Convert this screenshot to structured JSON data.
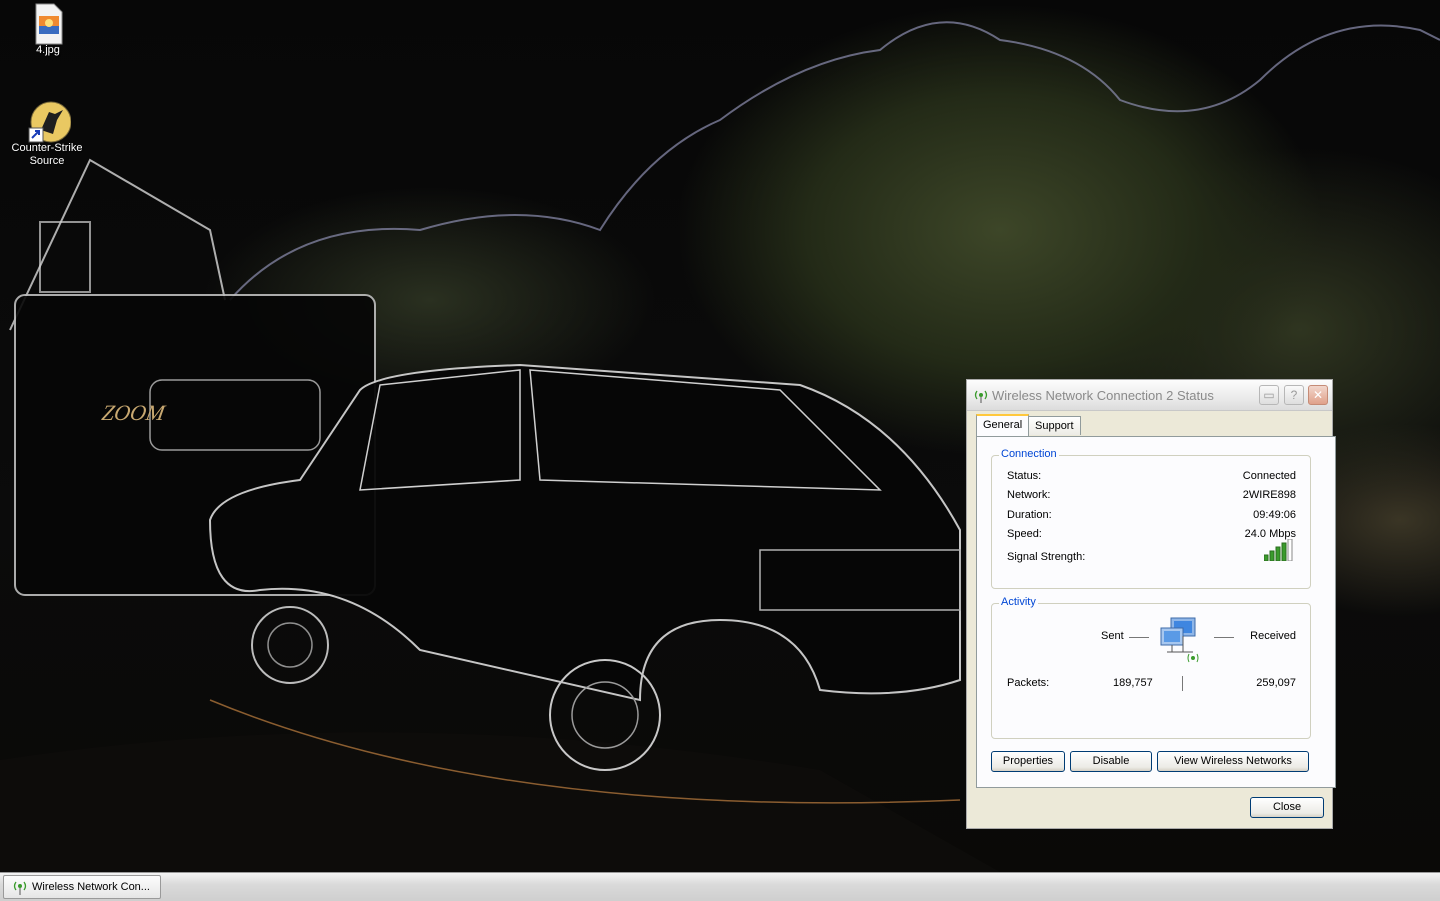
{
  "desktop": {
    "icons": [
      {
        "label": "4.jpg",
        "icon": "image-file-icon"
      },
      {
        "label": "Counter-Strike Source",
        "icon": "counter-strike-icon"
      }
    ]
  },
  "dialog": {
    "title": "Wireless Network Connection 2 Status",
    "tabs": [
      "General",
      "Support"
    ],
    "active_tab": "General",
    "connection": {
      "label": "Connection",
      "status_label": "Status:",
      "status_value": "Connected",
      "network_label": "Network:",
      "network_value": "2WIRE898",
      "duration_label": "Duration:",
      "duration_value": "09:49:06",
      "speed_label": "Speed:",
      "speed_value": "24.0 Mbps",
      "signal_label": "Signal Strength:",
      "signal_bars": 5,
      "signal_bars_active": 4
    },
    "activity": {
      "label": "Activity",
      "sent_label": "Sent",
      "received_label": "Received",
      "packets_label": "Packets:",
      "packets_sent": "189,757",
      "packets_received": "259,097"
    },
    "buttons": {
      "properties": "Properties",
      "disable": "Disable",
      "view_networks": "View Wireless Networks",
      "close": "Close"
    },
    "titlebar_buttons": {
      "help": "?",
      "close": "✕"
    },
    "colors": {
      "group_label": "#0046d5",
      "signal_on": "#3a9b2c",
      "tab_highlight": "#ffc83c"
    }
  },
  "taskbar": {
    "items": [
      {
        "label": "Wireless Network Con...",
        "icon": "wireless-network-icon"
      }
    ]
  }
}
